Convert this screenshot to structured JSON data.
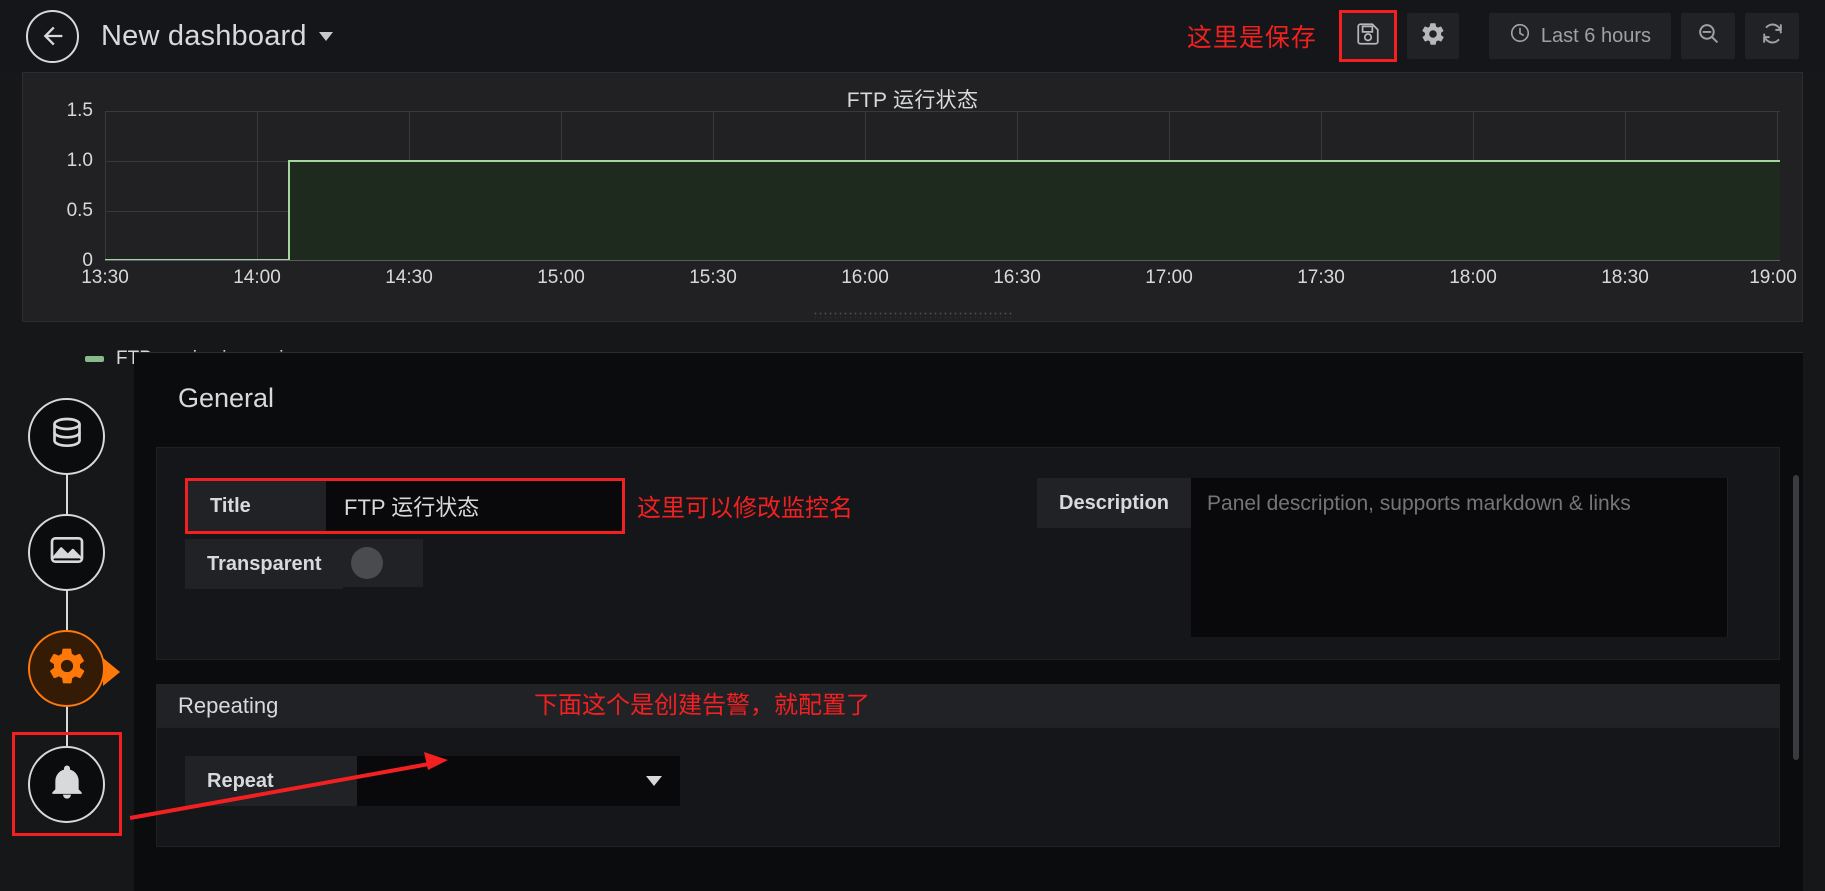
{
  "header": {
    "back_icon": "arrow-left-icon",
    "title": "New dashboard",
    "caret_icon": "chevron-down-icon",
    "save_annotation": "这里是保存",
    "save_icon": "save-floppy-icon",
    "settings_icon": "gear-icon",
    "time_range": "Last 6 hours",
    "clock_icon": "clock-icon",
    "zoom_out_icon": "zoom-out-icon",
    "refresh_icon": "refresh-icon",
    "highlight_color": "#f22020"
  },
  "panel": {
    "title": "FTP 运行状态",
    "legend": {
      "label": "FTP service is running",
      "color": "#8ab98a"
    },
    "resize_handle": "panel-resize-handle"
  },
  "chart_data": {
    "type": "line",
    "title": "FTP 运行状态",
    "xlabel": "",
    "ylabel": "",
    "ylim": [
      0,
      1.5
    ],
    "yticks": [
      "0",
      "0.5",
      "1.0",
      "1.5"
    ],
    "ytick_values": [
      0,
      0.5,
      1.0,
      1.5
    ],
    "xticks": [
      "13:30",
      "14:00",
      "14:30",
      "15:00",
      "15:30",
      "16:00",
      "16:30",
      "17:00",
      "17:30",
      "18:00",
      "18:30",
      "19:00"
    ],
    "grid": true,
    "legend_position": "bottom-left",
    "series": [
      {
        "name": "FTP service is running",
        "color": "#8ab98a",
        "fill": true,
        "x": [
          "13:20",
          "13:55",
          "14:00",
          "19:10"
        ],
        "values": [
          0,
          0,
          1,
          1
        ]
      }
    ],
    "annotations": []
  },
  "editor": {
    "section_title": "General",
    "title_field": {
      "label": "Title",
      "value": "FTP 运行状态",
      "annotation": "这里可以修改监控名"
    },
    "transparent_field": {
      "label": "Transparent",
      "enabled": false
    },
    "description_field": {
      "label": "Description",
      "value": "",
      "placeholder": "Panel description, supports markdown & links"
    },
    "repeating": {
      "section_title": "Repeating",
      "annotation": "下面这个是创建告警，就配置了",
      "repeat_label": "Repeat",
      "repeat_value": "",
      "caret_icon": "chevron-down-icon"
    }
  },
  "sidebar": {
    "items": [
      {
        "name": "queries-tab",
        "icon": "database-icon",
        "active": false
      },
      {
        "name": "visualization-tab",
        "icon": "graph-image-icon",
        "active": false
      },
      {
        "name": "general-tab",
        "icon": "gear-icon",
        "active": true
      },
      {
        "name": "alert-tab",
        "icon": "bell-icon",
        "active": false,
        "highlighted": true
      }
    ],
    "active_color": "#ff780a",
    "highlight_color": "#f22020"
  }
}
